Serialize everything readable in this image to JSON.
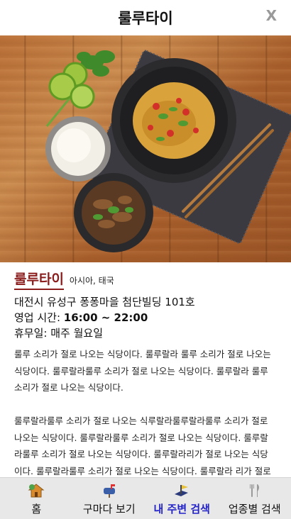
{
  "header": {
    "title": "룰루타이",
    "close_label": "X"
  },
  "restaurant": {
    "name": "룰루타이",
    "category": "아시아, 태국",
    "address": "대전시 유성구 퐁퐁마을 첨단빌딩 101호",
    "hours_label": "영업 시간: ",
    "hours_value": "16:00 ~ 22:00",
    "holiday_label": "휴무일: ",
    "holiday_value": "매주 월요일"
  },
  "description": [
    "룰루 소리가 절로 나오는 식당이다. 룰루랄라 룰루 소리가 절로 나오는 식당이다. 룰루랄라룰루 소리가 절로 나오는 식당이다. 룰루랄라 룰루 소리가 절로 나오는 식당이다.",
    "룰루랄라룰루 소리가 절로 나오는 식루랄라룰루랄라룰루 소리가 절로 나오는 식당이다. 룰루랄라룰루 소리가 절로 나오는 식당이다. 룰루랄라룰루 소리가 절로 나오는 식당이다. 룰루랄라리가 절로 나오는 식당이다. 룰루랄라룰루 소리가 절로 나오는 식당이다. 룰루랄라 리가 절로 나오는 식당이다. 룰루랄라룰루 소리가 절로 나오는 식당"
  ],
  "tabs": [
    {
      "label": "홈",
      "icon": "home-icon",
      "active": false
    },
    {
      "label": "구마다 보기",
      "icon": "mailbox-icon",
      "active": false
    },
    {
      "label": "내 주변 검색",
      "icon": "map-flag-icon",
      "active": true
    },
    {
      "label": "업종별 검색",
      "icon": "fork-knife-icon",
      "active": false
    }
  ],
  "colors": {
    "name_accent": "#8a1c1c",
    "active_tab": "#2323c8",
    "tabbar_bg": "#e8e8e8"
  }
}
